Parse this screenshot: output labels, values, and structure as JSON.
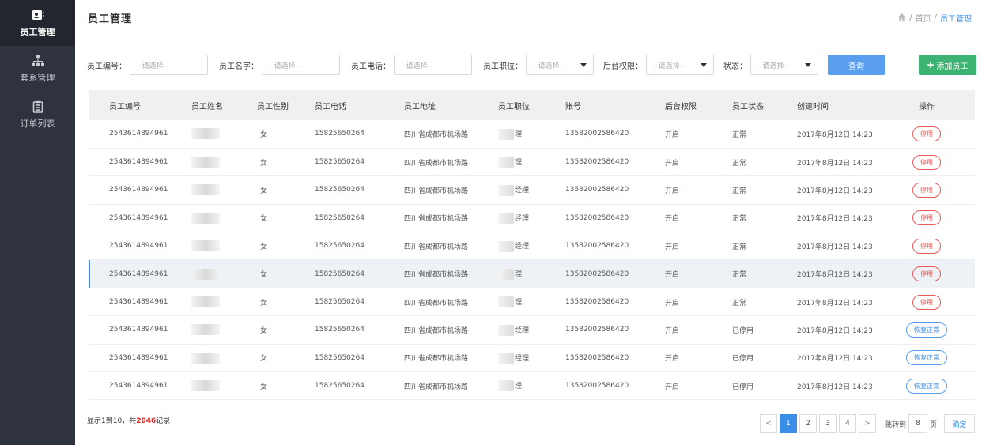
{
  "sidebar": {
    "items": [
      {
        "label": "员工管理",
        "icon": "contact-card-icon",
        "active": true
      },
      {
        "label": "套系管理",
        "icon": "sitemap-icon",
        "active": false
      },
      {
        "label": "订单列表",
        "icon": "clipboard-list-icon",
        "active": false
      }
    ]
  },
  "header": {
    "title": "员工管理",
    "breadcrumb": {
      "home_icon": "home-icon",
      "home": "首页",
      "sep": "/",
      "current": "员工管理"
    }
  },
  "filters": {
    "emp_no_label": "员工编号：",
    "emp_no_placeholder": "--请选择--",
    "emp_name_label": "员工名字：",
    "emp_name_placeholder": "--请选择--",
    "emp_phone_label": "员工电话：",
    "emp_phone_placeholder": "--请选择--",
    "position_label": "员工职位：",
    "position_value": "--请选择--",
    "permission_label": "后台权限：",
    "permission_value": "--请选择--",
    "status_label": "状态：",
    "status_value": "--请选择--",
    "query_button": "查询",
    "add_button": "添加员工"
  },
  "table": {
    "columns": [
      "员工编号",
      "员工姓名",
      "员工性别",
      "员工电话",
      "员工地址",
      "员工职位",
      "账号",
      "后台权限",
      "员工状态",
      "创建时间",
      "操作"
    ],
    "rows": [
      {
        "emp_no": "2543614894961",
        "gender": "女",
        "phone": "15825650264",
        "address": "四川省成都市机场路",
        "position_suffix": "理",
        "account": "13582002586420",
        "permission": "开启",
        "status": "正常",
        "created": "2017年8月12日  14:23",
        "action": "停用",
        "action_type": "stop"
      },
      {
        "emp_no": "2543614894961",
        "gender": "女",
        "phone": "15825650264",
        "address": "四川省成都市机场路",
        "position_suffix": "理",
        "account": "13582002586420",
        "permission": "开启",
        "status": "正常",
        "created": "2017年8月12日  14:23",
        "action": "停用",
        "action_type": "stop"
      },
      {
        "emp_no": "2543614894961",
        "gender": "女",
        "phone": "15825650264",
        "address": "四川省成都市机场路",
        "position_suffix": "经理",
        "account": "13582002586420",
        "permission": "开启",
        "status": "正常",
        "created": "2017年8月12日  14:23",
        "action": "停用",
        "action_type": "stop"
      },
      {
        "emp_no": "2543614894961",
        "gender": "女",
        "phone": "15825650264",
        "address": "四川省成都市机场路",
        "position_suffix": "经理",
        "account": "13582002586420",
        "permission": "开启",
        "status": "正常",
        "created": "2017年8月12日  14:23",
        "action": "停用",
        "action_type": "stop"
      },
      {
        "emp_no": "2543614894961",
        "gender": "女",
        "phone": "15825650264",
        "address": "四川省成都市机场路",
        "position_suffix": "经理",
        "account": "13582002586420",
        "permission": "开启",
        "status": "正常",
        "created": "2017年8月12日  14:23",
        "action": "停用",
        "action_type": "stop"
      },
      {
        "emp_no": "2543614894961",
        "gender": "女",
        "phone": "15825650264",
        "address": "四川省成都市机场路",
        "position_suffix": "理",
        "account": "13582002586420",
        "permission": "开启",
        "status": "正常",
        "created": "2017年8月12日  14:23",
        "action": "停用",
        "action_type": "stop",
        "highlight": true
      },
      {
        "emp_no": "2543614894961",
        "gender": "女",
        "phone": "15825650264",
        "address": "四川省成都市机场路",
        "position_suffix": "理",
        "account": "13582002586420",
        "permission": "开启",
        "status": "正常",
        "created": "2017年8月12日  14:23",
        "action": "停用",
        "action_type": "stop"
      },
      {
        "emp_no": "2543614894961",
        "gender": "女",
        "phone": "15825650264",
        "address": "四川省成都市机场路",
        "position_suffix": "经理",
        "account": "13582002586420",
        "permission": "开启",
        "status": "已停用",
        "created": "2017年8月12日  14:23",
        "action": "恢复正常",
        "action_type": "restore"
      },
      {
        "emp_no": "2543614894961",
        "gender": "女",
        "phone": "15825650264",
        "address": "四川省成都市机场路",
        "position_suffix": "经理",
        "account": "13582002586420",
        "permission": "开启",
        "status": "已停用",
        "created": "2017年8月12日  14:23",
        "action": "恢复正常",
        "action_type": "restore"
      },
      {
        "emp_no": "2543614894961",
        "gender": "女",
        "phone": "15825650264",
        "address": "四川省成都市机场路",
        "position_suffix": "理",
        "account": "13582002586420",
        "permission": "开启",
        "status": "已停用",
        "created": "2017年8月12日  14:23",
        "action": "恢复正常",
        "action_type": "restore"
      }
    ]
  },
  "footer": {
    "summary_prefix": "显示1到10，共",
    "summary_total": "2046",
    "summary_suffix": "记录",
    "pages": [
      "1",
      "2",
      "3",
      "4"
    ],
    "current_page": "1",
    "prev": "<",
    "next": ">",
    "jump_label": "跳转到",
    "jump_value": "8",
    "page_unit": "页",
    "confirm": "确定"
  },
  "colors": {
    "sidebar_bg": "#2f333e",
    "accent_blue": "#3a8ee6",
    "add_green": "#3cb370",
    "stop_red": "#e85a5a",
    "total_red": "#e02020"
  }
}
